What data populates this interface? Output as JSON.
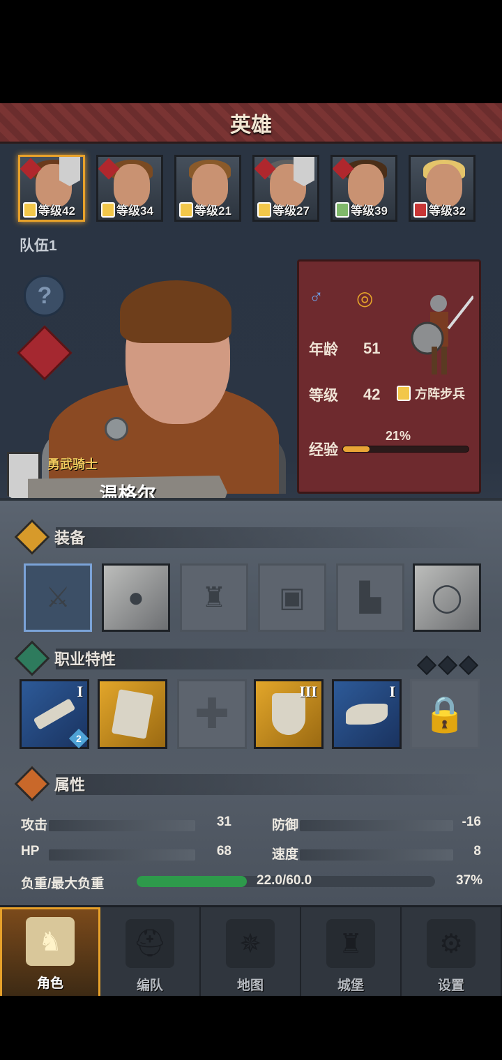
{
  "title": "英雄",
  "roster": [
    {
      "level": "等级42",
      "class_icon": "shield-icon",
      "faction": true,
      "banner": true,
      "selected": true
    },
    {
      "level": "等级34",
      "class_icon": "shield-icon",
      "faction": true,
      "banner": false,
      "selected": false
    },
    {
      "level": "等级21",
      "class_icon": "shield-icon",
      "faction": false,
      "banner": false,
      "selected": false
    },
    {
      "level": "等级27",
      "class_icon": "shield-icon",
      "faction": true,
      "banner": true,
      "selected": false
    },
    {
      "level": "等级39",
      "class_icon": "crossed-swords-icon",
      "faction": true,
      "banner": false,
      "selected": false
    },
    {
      "level": "等级32",
      "class_icon": "horse-icon",
      "faction": false,
      "banner": false,
      "selected": false
    }
  ],
  "team_label": "队伍1",
  "hero": {
    "title": "勇武骑士",
    "name": "温格尔",
    "gender_icon": "♂",
    "ring_icon": "◎",
    "age_label": "年龄",
    "age": "51",
    "level_label": "等级",
    "level": "42",
    "unit_type": "方阵步兵",
    "exp_label": "经验",
    "exp_pct": "21%",
    "exp_fraction": 0.21
  },
  "equipment": {
    "label": "装备"
  },
  "traits": {
    "label": "职业特性",
    "items": [
      {
        "roman": "I",
        "badge": "2"
      },
      {
        "roman": "",
        "badge": ""
      },
      {
        "roman": "",
        "badge": ""
      },
      {
        "roman": "III",
        "badge": ""
      },
      {
        "roman": "I",
        "badge": ""
      }
    ]
  },
  "attributes": {
    "label": "属性",
    "attack_label": "攻击",
    "attack": "31",
    "defense_label": "防御",
    "defense": "-16",
    "hp_label": "HP",
    "hp": "68",
    "speed_label": "速度",
    "speed": "8",
    "load_label": "负重/最大负重",
    "load": "22.0/60.0",
    "load_pct": "37%",
    "load_fraction": 0.37
  },
  "nav": [
    {
      "label": "角色",
      "icon": "knight-icon"
    },
    {
      "label": "编队",
      "icon": "helmet-icon"
    },
    {
      "label": "地图",
      "icon": "compass-icon"
    },
    {
      "label": "城堡",
      "icon": "castle-icon"
    },
    {
      "label": "设置",
      "icon": "gear-icon"
    }
  ],
  "colors": {
    "accent": "#e7a12a",
    "panel_red": "#6e2a2e",
    "exp": "#e9a536",
    "load": "#2e9a4b"
  }
}
